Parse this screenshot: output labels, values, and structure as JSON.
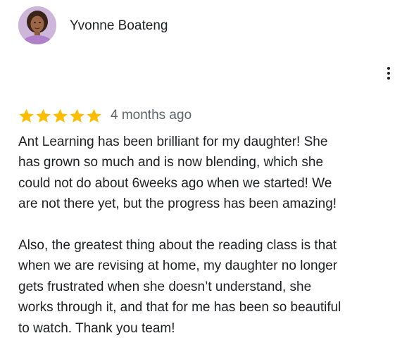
{
  "review": {
    "reviewer_name": "Yvonne Boateng",
    "avatar_icon": "profile-photo",
    "more_icon": "vertical-dots-icon",
    "rating": 5,
    "rating_max": 5,
    "star_color": "#fbbc04",
    "time_ago": "4 months ago",
    "paragraph1_lines": [
      "Ant Learning has been brilliant for my daughter! She",
      "has grown so much and is now blending, which she",
      "could not do about 6weeks ago when we started! We",
      "are not there yet, but the progress has been amazing!"
    ],
    "paragraph2_lines": [
      "Also, the greatest thing about the reading class is that",
      "when we are revising at home, my daughter no longer",
      "gets frustrated when she doesn’t understand, she",
      "works through it, and that for me has been so beautiful",
      "to watch. Thank you team!"
    ]
  }
}
